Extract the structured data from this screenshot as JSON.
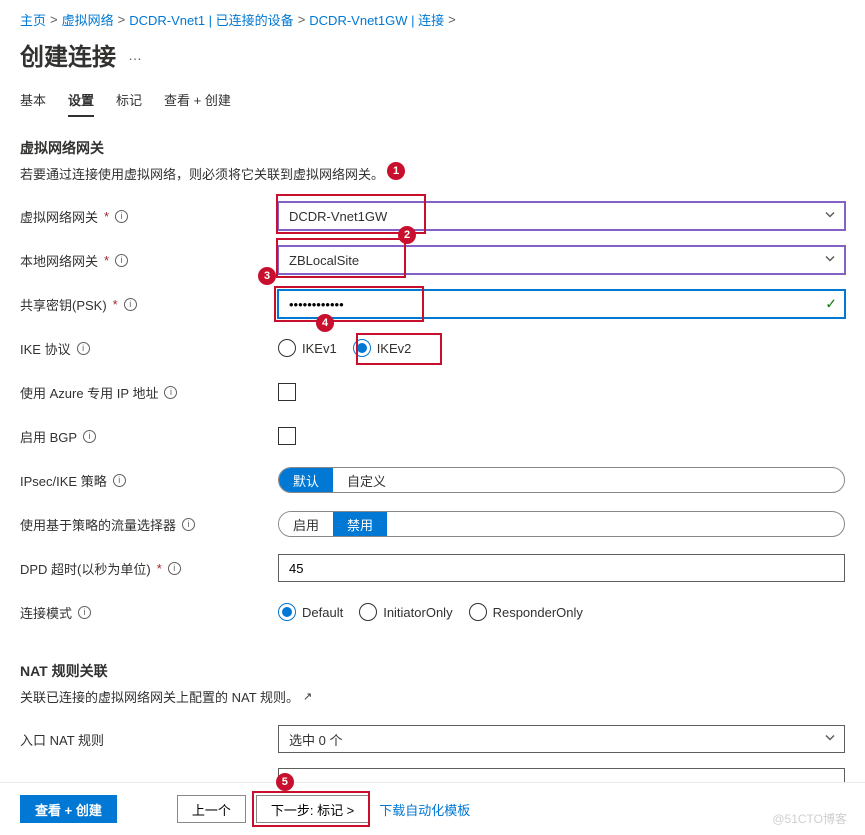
{
  "breadcrumb": {
    "items": [
      "主页",
      "虚拟网络",
      "DCDR-Vnet1 | 已连接的设备",
      "DCDR-Vnet1GW | 连接"
    ],
    "sep": ">"
  },
  "page": {
    "title": "创建连接",
    "more": "…"
  },
  "tabs": [
    "基本",
    "设置",
    "标记",
    "查看 + 创建"
  ],
  "active_tab": 1,
  "section1": {
    "title": "虚拟网络网关",
    "desc": "若要通过连接使用虚拟网络，则必须将它关联到虚拟网络网关。"
  },
  "fields": {
    "vng": {
      "label": "虚拟网络网关",
      "value": "DCDR-Vnet1GW"
    },
    "lng": {
      "label": "本地网络网关",
      "value": "ZBLocalSite"
    },
    "psk": {
      "label": "共享密钥(PSK)",
      "value": "••••••••••••"
    },
    "ike": {
      "label": "IKE 协议",
      "options": [
        "IKEv1",
        "IKEv2"
      ],
      "selected": 1
    },
    "azure_ip": {
      "label": "使用 Azure 专用 IP 地址"
    },
    "bgp": {
      "label": "启用 BGP"
    },
    "ipsec": {
      "label": "IPsec/IKE 策略",
      "options": [
        "默认",
        "自定义"
      ],
      "selected": 0
    },
    "selector": {
      "label": "使用基于策略的流量选择器",
      "options": [
        "启用",
        "禁用"
      ],
      "selected": 1
    },
    "dpd": {
      "label": "DPD 超时(以秒为单位)",
      "value": "45"
    },
    "mode": {
      "label": "连接模式",
      "options": [
        "Default",
        "InitiatorOnly",
        "ResponderOnly"
      ],
      "selected": 0
    }
  },
  "section2": {
    "title": "NAT 规则关联",
    "desc": "关联已连接的虚拟网络网关上配置的 NAT 规则。"
  },
  "nat_in": {
    "label": "入口 NAT 规则",
    "value": "选中 0 个"
  },
  "footer": {
    "review": "查看 + 创建",
    "prev": "上一个",
    "next": "下一步: 标记 >",
    "download": "下载自动化模板"
  },
  "callouts": [
    "1",
    "2",
    "3",
    "4",
    "5"
  ],
  "watermark": "@51CTO博客"
}
